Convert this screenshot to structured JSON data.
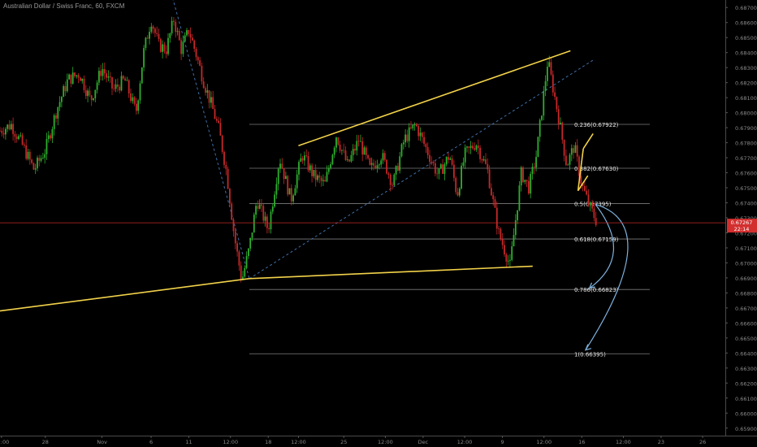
{
  "title": "Australian Dollar / Swiss Franc, 60, FXCM",
  "chart_data": {
    "type": "candlestick",
    "symbol": "Australian Dollar / Swiss Franc",
    "interval": "60",
    "source": "FXCM",
    "y_axis": {
      "ticks": [
        "0.68700",
        "0.68600",
        "0.68500",
        "0.68400",
        "0.68300",
        "0.68200",
        "0.68100",
        "0.68000",
        "0.67900",
        "0.67800",
        "0.67700",
        "0.67600",
        "0.67500",
        "0.67400",
        "0.67300",
        "0.67200",
        "0.67100",
        "0.67000",
        "0.66900",
        "0.66800",
        "0.66700",
        "0.66600",
        "0.66500",
        "0.66400",
        "0.66300",
        "0.66200",
        "0.66100",
        "0.66000",
        "0.65900"
      ],
      "ylim": [
        0.6585,
        0.6875
      ]
    },
    "x_axis": {
      "ticks": [
        "12:00",
        "28",
        "Nov",
        "6",
        "11",
        "12:00",
        "18",
        "12:00",
        "25",
        "12:00",
        "Dec",
        "12:00",
        "9",
        "12:00",
        "16",
        "12:00",
        "23",
        "26"
      ],
      "tick_positions": [
        0.02,
        0.6,
        1.35,
        2.0,
        2.5,
        3.05,
        3.55,
        3.95,
        4.55,
        5.1,
        5.6,
        6.15,
        6.65,
        7.2,
        7.7,
        8.25,
        8.75,
        9.3
      ]
    },
    "current_price": {
      "value": 0.67267,
      "label": "0.67267",
      "countdown": "22:14"
    },
    "fibonacci": {
      "levels": [
        {
          "ratio": "0.236",
          "price": 0.67922,
          "label": "0.236(0.67922)"
        },
        {
          "ratio": "0.382",
          "price": 0.6763,
          "label": "0.382(0.67630)"
        },
        {
          "ratio": "0.5",
          "price": 0.67395,
          "label": "0.5(0.67395)"
        },
        {
          "ratio": "0.618",
          "price": 0.67159,
          "label": "0.618(0.67159)"
        },
        {
          "ratio": "0.786",
          "price": 0.66823,
          "label": "0.786(0.66823)"
        },
        {
          "ratio": "1",
          "price": 0.66395,
          "label": "1(0.66395)"
        }
      ],
      "x_start": 3.3,
      "x_end": 8.6
    },
    "price_series": {
      "x": [
        0,
        0.15,
        0.3,
        0.45,
        0.6,
        0.75,
        0.9,
        1.05,
        1.2,
        1.35,
        1.5,
        1.65,
        1.8,
        1.9,
        2.0,
        2.1,
        2.2,
        2.3,
        2.4,
        2.5,
        2.6,
        2.7,
        2.8,
        2.9,
        3.0,
        3.1,
        3.2,
        3.3,
        3.4,
        3.55,
        3.7,
        3.85,
        4.0,
        4.15,
        4.3,
        4.45,
        4.6,
        4.75,
        4.9,
        5.05,
        5.2,
        5.35,
        5.5,
        5.65,
        5.8,
        5.95,
        6.05,
        6.15,
        6.3,
        6.45,
        6.6,
        6.75,
        6.9,
        7.0,
        7.1,
        7.25,
        7.4,
        7.5,
        7.6,
        7.7,
        7.8,
        7.9
      ],
      "close": [
        0.6788,
        0.6792,
        0.6778,
        0.6762,
        0.6775,
        0.6802,
        0.6822,
        0.6826,
        0.6808,
        0.683,
        0.6815,
        0.6822,
        0.68,
        0.684,
        0.6862,
        0.6845,
        0.6842,
        0.6862,
        0.6842,
        0.6855,
        0.6838,
        0.682,
        0.6805,
        0.6788,
        0.676,
        0.6718,
        0.6688,
        0.671,
        0.6742,
        0.6722,
        0.677,
        0.6742,
        0.6772,
        0.6758,
        0.6752,
        0.6785,
        0.6765,
        0.6782,
        0.6762,
        0.6772,
        0.6752,
        0.6782,
        0.6792,
        0.6775,
        0.6758,
        0.6772,
        0.6745,
        0.6772,
        0.678,
        0.6762,
        0.672,
        0.6698,
        0.676,
        0.675,
        0.6772,
        0.6835,
        0.6795,
        0.6765,
        0.6778,
        0.6752,
        0.6738,
        0.6727
      ]
    },
    "trendlines": [
      {
        "name": "lower-long",
        "x": [
          0,
          3.3
        ],
        "y": [
          0.6668,
          0.66895
        ]
      },
      {
        "name": "lower-flat",
        "x": [
          3.3,
          7.05
        ],
        "y": [
          0.66895,
          0.66978
        ]
      },
      {
        "name": "upper-channel",
        "x": [
          3.95,
          7.55
        ],
        "y": [
          0.6778,
          0.68412
        ]
      },
      {
        "name": "flag-upper",
        "x": [
          7.72,
          7.85
        ],
        "y": [
          0.6776,
          0.6786
        ]
      },
      {
        "name": "flag-lower",
        "x": [
          7.65,
          7.78
        ],
        "y": [
          0.6748,
          0.6758
        ]
      },
      {
        "name": "flag-side",
        "x": [
          7.72,
          7.65
        ],
        "y": [
          0.6776,
          0.6748
        ]
      }
    ],
    "dashed_lines": [
      {
        "x": [
          2.2,
          3.3
        ],
        "y": [
          0.6892,
          0.66895
        ]
      },
      {
        "x": [
          3.3,
          7.85
        ],
        "y": [
          0.66895,
          0.6835
        ]
      }
    ],
    "xlim": [
      0,
      9.6
    ],
    "grid": false
  }
}
